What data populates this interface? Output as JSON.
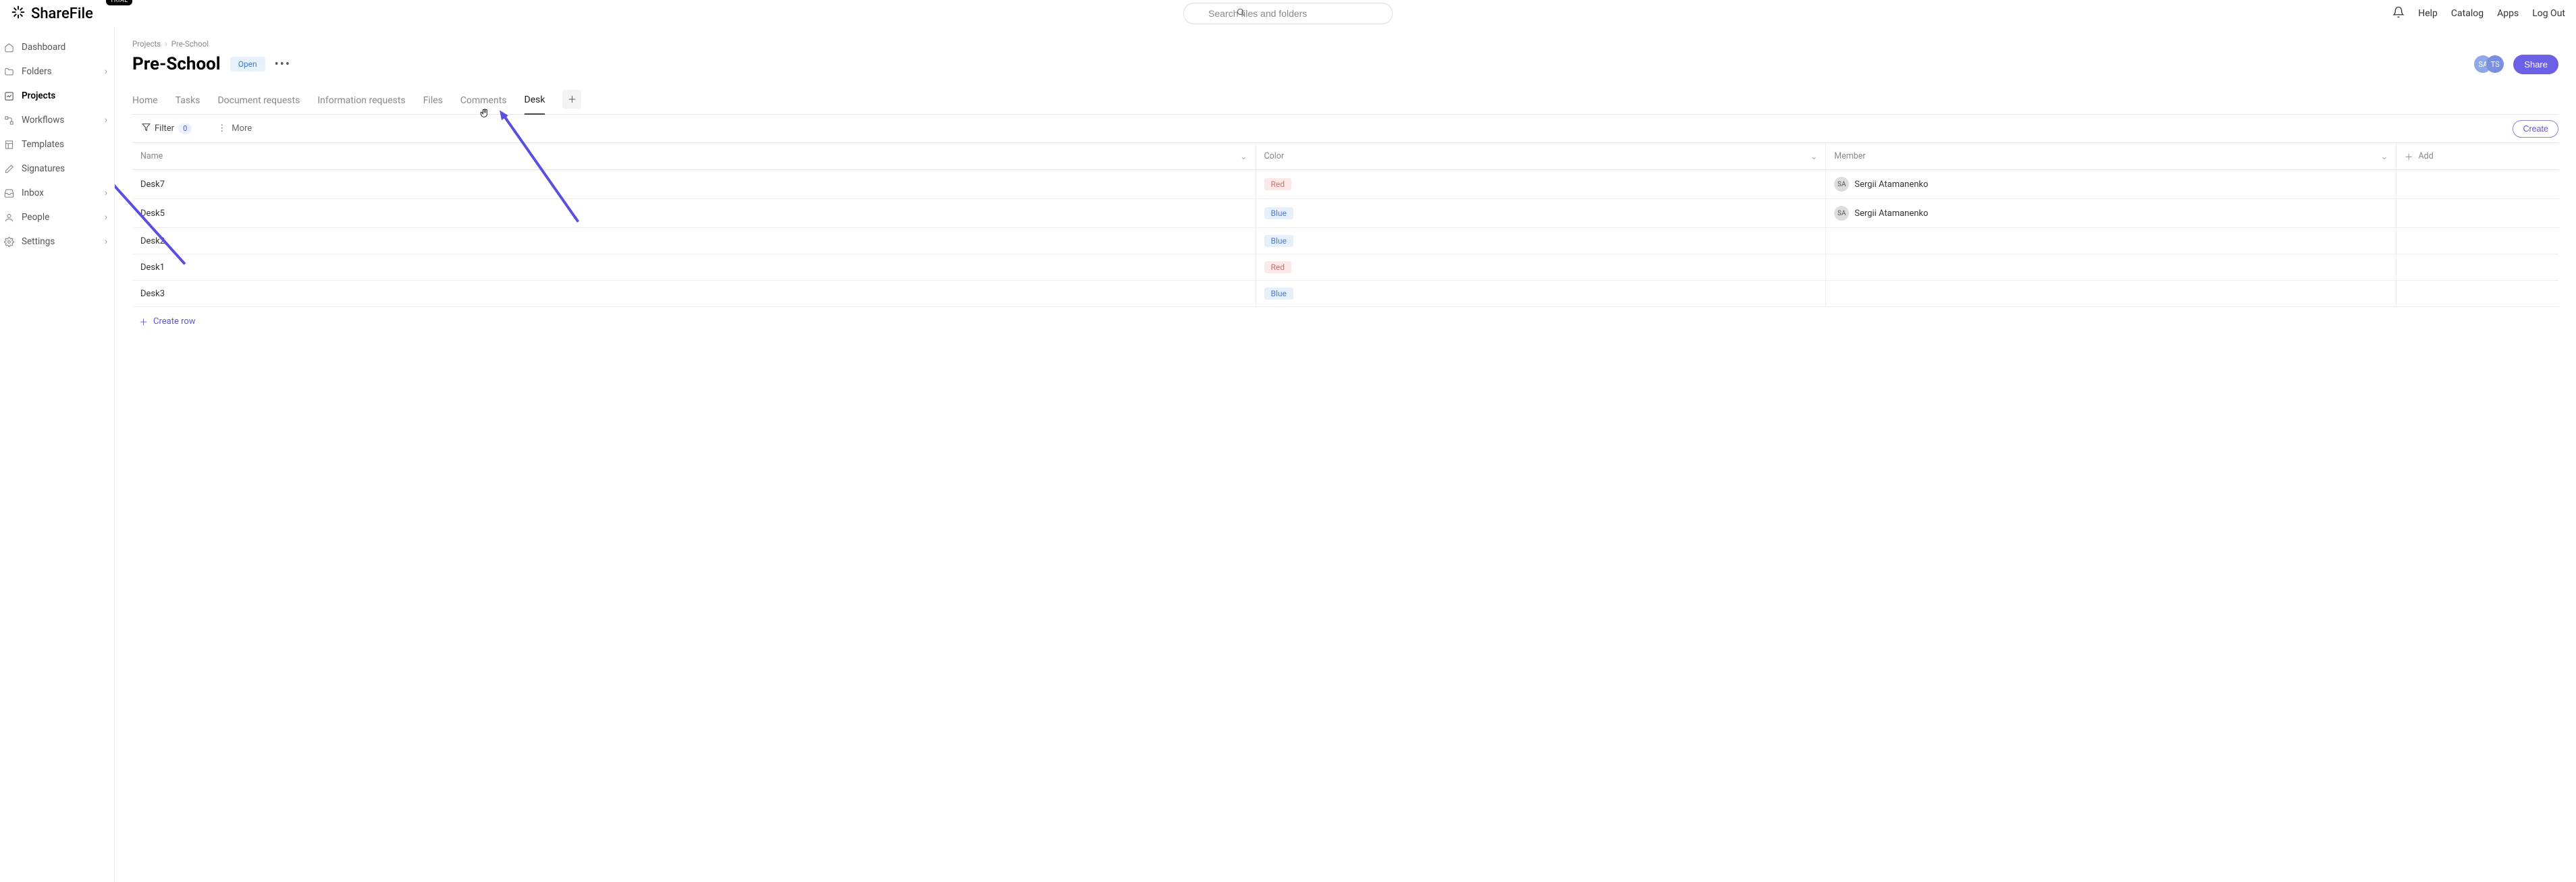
{
  "brand": {
    "name": "ShareFile",
    "badge": "TRIAL"
  },
  "search": {
    "placeholder": "Search files and folders"
  },
  "topnav": {
    "help": "Help",
    "catalog": "Catalog",
    "apps": "Apps",
    "logout": "Log Out"
  },
  "sidebar": {
    "items": [
      {
        "label": "Dashboard",
        "icon": "home",
        "chev": false,
        "active": false
      },
      {
        "label": "Folders",
        "icon": "folder",
        "chev": true,
        "active": false
      },
      {
        "label": "Projects",
        "icon": "projects",
        "chev": false,
        "active": true
      },
      {
        "label": "Workflows",
        "icon": "flow",
        "chev": true,
        "active": false
      },
      {
        "label": "Templates",
        "icon": "template",
        "chev": false,
        "active": false
      },
      {
        "label": "Signatures",
        "icon": "sign",
        "chev": false,
        "active": false
      },
      {
        "label": "Inbox",
        "icon": "inbox",
        "chev": true,
        "active": false
      },
      {
        "label": "People",
        "icon": "people",
        "chev": true,
        "active": false
      },
      {
        "label": "Settings",
        "icon": "gear",
        "chev": true,
        "active": false
      }
    ]
  },
  "breadcrumbs": {
    "root": "Projects",
    "current": "Pre-School"
  },
  "page": {
    "title": "Pre-School",
    "status": "Open",
    "avatars": [
      {
        "initials": "SA",
        "cls": "av-sa"
      },
      {
        "initials": "TS",
        "cls": "av-ts"
      }
    ],
    "share": "Share"
  },
  "tabs": [
    {
      "label": "Home",
      "active": false
    },
    {
      "label": "Tasks",
      "active": false
    },
    {
      "label": "Document requests",
      "active": false
    },
    {
      "label": "Information requests",
      "active": false
    },
    {
      "label": "Files",
      "active": false
    },
    {
      "label": "Comments",
      "active": false
    },
    {
      "label": "Desk",
      "active": true
    }
  ],
  "toolbar": {
    "filter_label": "Filter",
    "filter_count": "0",
    "more_label": "More",
    "create_label": "Create"
  },
  "table": {
    "columns": {
      "name": "Name",
      "color": "Color",
      "member": "Member",
      "add": "Add"
    },
    "rows": [
      {
        "name": "Desk7",
        "color": "Red",
        "color_cls": "tag-red",
        "member": "Sergii Atamanenko",
        "member_av": "SA"
      },
      {
        "name": "Desk5",
        "color": "Blue",
        "color_cls": "tag-blue",
        "member": "Sergii Atamanenko",
        "member_av": "SA"
      },
      {
        "name": "Desk2",
        "color": "Blue",
        "color_cls": "tag-blue",
        "member": "",
        "member_av": ""
      },
      {
        "name": "Desk1",
        "color": "Red",
        "color_cls": "tag-red",
        "member": "",
        "member_av": ""
      },
      {
        "name": "Desk3",
        "color": "Blue",
        "color_cls": "tag-blue",
        "member": "",
        "member_av": ""
      }
    ],
    "create_row": "Create row"
  }
}
